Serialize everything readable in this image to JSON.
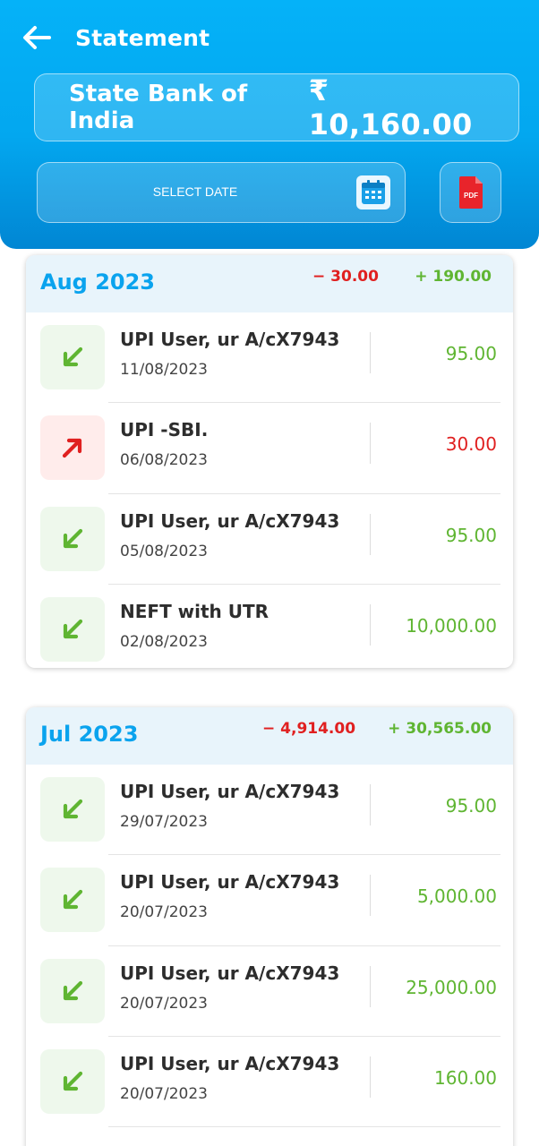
{
  "header": {
    "title": "Statement",
    "bank_name": "State Bank of India",
    "balance": "₹ 10,160.00",
    "select_date_label": "SELECT DATE",
    "pdf_label": "PDF"
  },
  "months": [
    {
      "name": "Aug 2023",
      "debit_total": "− 30.00",
      "credit_total": "+ 190.00",
      "transactions": [
        {
          "name": "UPI User, ur A/cX7943",
          "date": "11/08/2023",
          "amount": "95.00",
          "type": "credit"
        },
        {
          "name": "UPI -SBI.",
          "date": "06/08/2023",
          "amount": "30.00",
          "type": "debit"
        },
        {
          "name": "UPI User, ur A/cX7943",
          "date": "05/08/2023",
          "amount": "95.00",
          "type": "credit"
        },
        {
          "name": "NEFT with UTR",
          "date": "02/08/2023",
          "amount": "10,000.00",
          "type": "credit"
        }
      ]
    },
    {
      "name": "Jul 2023",
      "debit_total": "− 4,914.00",
      "credit_total": "+ 30,565.00",
      "transactions": [
        {
          "name": "UPI User, ur A/cX7943",
          "date": "29/07/2023",
          "amount": "95.00",
          "type": "credit"
        },
        {
          "name": "UPI User, ur A/cX7943",
          "date": "20/07/2023",
          "amount": "5,000.00",
          "type": "credit"
        },
        {
          "name": "UPI User, ur A/cX7943",
          "date": "20/07/2023",
          "amount": "25,000.00",
          "type": "credit"
        },
        {
          "name": "UPI User, ur A/cX7943",
          "date": "20/07/2023",
          "amount": "160.00",
          "type": "credit"
        }
      ]
    }
  ],
  "colors": {
    "header_blue": "#05b2f8",
    "month_title": "#0aa3ee",
    "credit_green": "#5fb532",
    "debit_red": "#e02020"
  },
  "icons": {
    "back": "arrow-left-icon",
    "calendar": "calendar-icon",
    "pdf": "pdf-file-icon",
    "credit": "arrow-down-left-icon",
    "debit": "arrow-up-right-icon"
  }
}
